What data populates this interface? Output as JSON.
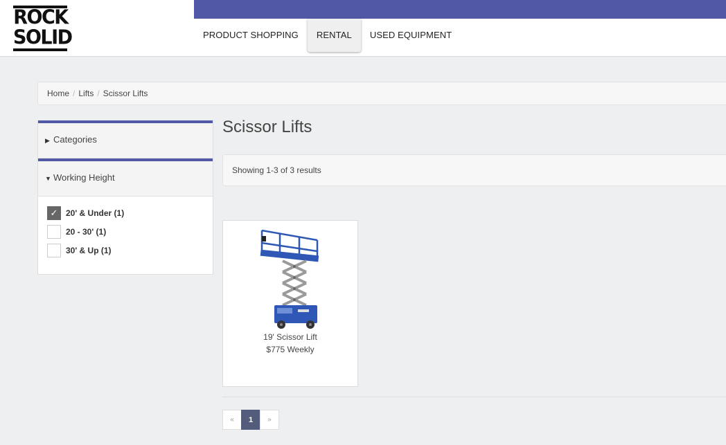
{
  "logo": {
    "line1": "ROCK",
    "line2": "SOLID"
  },
  "nav": {
    "items": [
      {
        "label": "PRODUCT SHOPPING",
        "active": false
      },
      {
        "label": "RENTAL",
        "active": true
      },
      {
        "label": "USED EQUIPMENT",
        "active": false
      }
    ]
  },
  "breadcrumb": {
    "items": [
      "Home",
      "Lifts",
      "Scissor Lifts"
    ],
    "separator": "/"
  },
  "sidebar": {
    "categories_label": "Categories",
    "categories_arrow": "▶",
    "working_height_label": "Working Height",
    "working_height_arrow": "▼",
    "filters": [
      {
        "label": "20' & Under (1)",
        "checked": true
      },
      {
        "label": "20 - 30' (1)",
        "checked": false
      },
      {
        "label": "30' & Up (1)",
        "checked": false
      }
    ],
    "check_glyph": "✓"
  },
  "main": {
    "title": "Scissor Lifts",
    "results_text": "Showing 1-3 of 3 results"
  },
  "products": [
    {
      "name": "19' Scissor Lift",
      "price": "$775 Weekly"
    }
  ],
  "pagination": {
    "prev": "«",
    "current": "1",
    "next": "»"
  },
  "colors": {
    "accent": "#5159a7",
    "page_bg": "#eeeff0",
    "pager_active": "#535d7b",
    "lift_blue": "#2f58b6"
  }
}
